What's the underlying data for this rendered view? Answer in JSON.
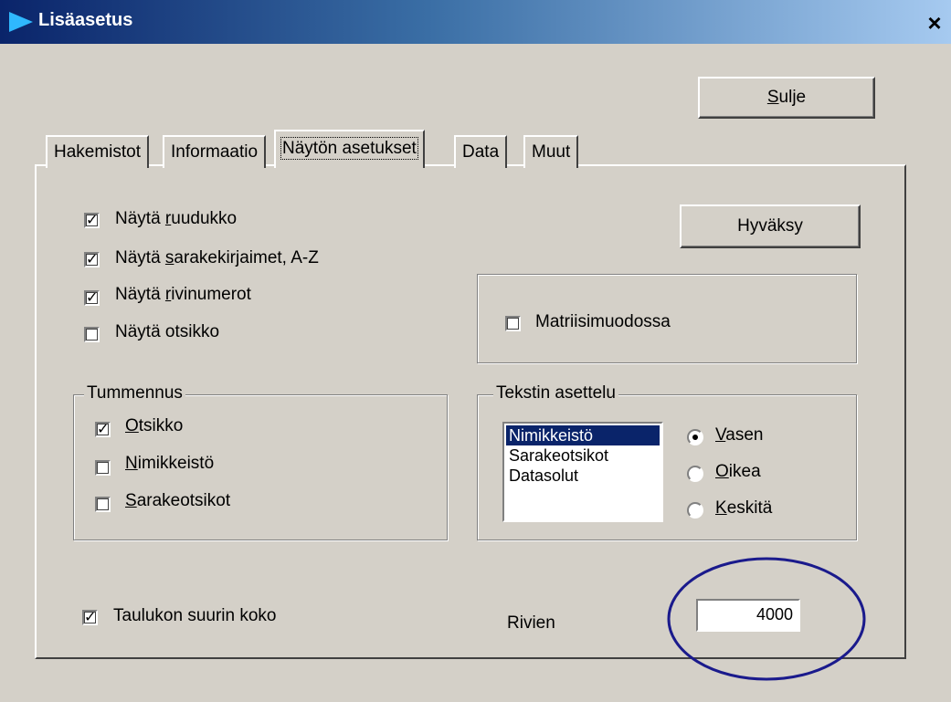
{
  "window": {
    "title": "Lisäasetus",
    "close_glyph": "×"
  },
  "buttons": {
    "close_label_pre": "",
    "close_label_u": "S",
    "close_label_post": "ulje",
    "accept_label": "Hyväksy"
  },
  "tabs": [
    {
      "label": "Hakemistot",
      "active": false
    },
    {
      "label": "Informaatio",
      "active": false
    },
    {
      "label": "Näytön asetukset",
      "active": true
    },
    {
      "label": "Data",
      "active": false
    },
    {
      "label": "Muut",
      "active": false
    }
  ],
  "display_options": {
    "show_grid": {
      "pre": "Näytä ",
      "u": "r",
      "post": "uudukko",
      "checked": true
    },
    "show_column_letters": {
      "pre": "Näytä ",
      "u": "s",
      "post": "arakekirjaimet, A-Z",
      "checked": true
    },
    "show_row_numbers": {
      "pre": "Näytä ",
      "u": "r",
      "post": "ivinumerot",
      "checked": true
    },
    "show_title": {
      "label": "Näytä otsikko",
      "checked": false
    }
  },
  "matrix": {
    "label": "Matriisimuodossa",
    "checked": false
  },
  "shading": {
    "legend": "Tummennus",
    "title": {
      "u": "O",
      "post": "tsikko",
      "checked": true
    },
    "nomenclature": {
      "u": "N",
      "post": "imikkeistö",
      "checked": false
    },
    "column_headers": {
      "u": "S",
      "post": "arakeotsikot",
      "checked": false
    }
  },
  "text_layout": {
    "legend": "Tekstin asettelu",
    "list": [
      "Nimikkeistö",
      "Sarakeotsikot",
      "Datasolut"
    ],
    "selected_index": 0,
    "align_left": {
      "u": "V",
      "post": "asen",
      "selected": true
    },
    "align_right": {
      "u": "O",
      "post": "ikea",
      "selected": false
    },
    "align_center": {
      "u": "K",
      "post": "eskitä",
      "selected": false
    }
  },
  "table_size": {
    "label": "Taulukon suurin koko",
    "checked": true,
    "rows_label": "Rivien",
    "rows_value": "4000"
  },
  "colors": {
    "title_start": "#0a246a",
    "selection": "#0a246a",
    "annotation_ellipse": "#1a1a8c",
    "face": "#d4d0c8"
  },
  "icons": {
    "app": "arrow-icon",
    "close": "close-icon"
  }
}
